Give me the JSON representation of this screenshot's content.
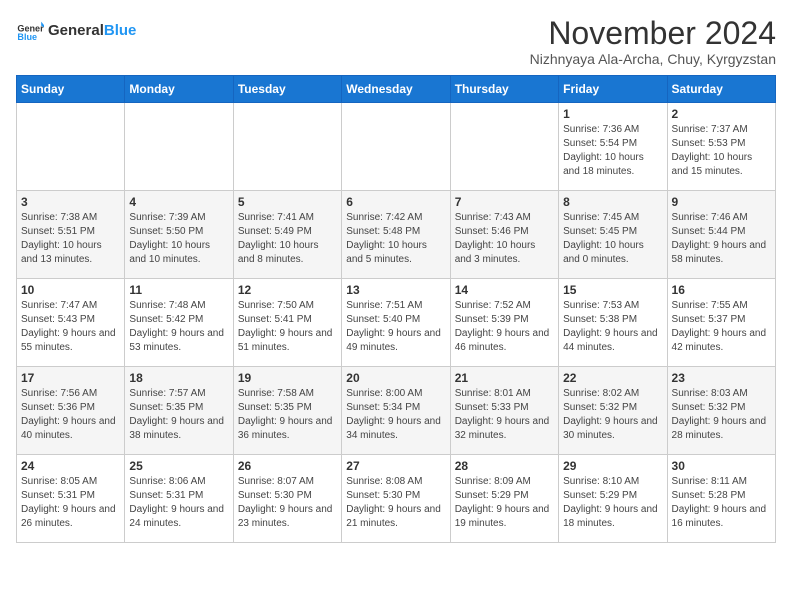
{
  "header": {
    "logo_general": "General",
    "logo_blue": "Blue",
    "month": "November 2024",
    "location": "Nizhnyaya Ala-Archa, Chuy, Kyrgyzstan"
  },
  "weekdays": [
    "Sunday",
    "Monday",
    "Tuesday",
    "Wednesday",
    "Thursday",
    "Friday",
    "Saturday"
  ],
  "weeks": [
    [
      {
        "day": "",
        "info": ""
      },
      {
        "day": "",
        "info": ""
      },
      {
        "day": "",
        "info": ""
      },
      {
        "day": "",
        "info": ""
      },
      {
        "day": "",
        "info": ""
      },
      {
        "day": "1",
        "info": "Sunrise: 7:36 AM\nSunset: 5:54 PM\nDaylight: 10 hours and 18 minutes."
      },
      {
        "day": "2",
        "info": "Sunrise: 7:37 AM\nSunset: 5:53 PM\nDaylight: 10 hours and 15 minutes."
      }
    ],
    [
      {
        "day": "3",
        "info": "Sunrise: 7:38 AM\nSunset: 5:51 PM\nDaylight: 10 hours and 13 minutes."
      },
      {
        "day": "4",
        "info": "Sunrise: 7:39 AM\nSunset: 5:50 PM\nDaylight: 10 hours and 10 minutes."
      },
      {
        "day": "5",
        "info": "Sunrise: 7:41 AM\nSunset: 5:49 PM\nDaylight: 10 hours and 8 minutes."
      },
      {
        "day": "6",
        "info": "Sunrise: 7:42 AM\nSunset: 5:48 PM\nDaylight: 10 hours and 5 minutes."
      },
      {
        "day": "7",
        "info": "Sunrise: 7:43 AM\nSunset: 5:46 PM\nDaylight: 10 hours and 3 minutes."
      },
      {
        "day": "8",
        "info": "Sunrise: 7:45 AM\nSunset: 5:45 PM\nDaylight: 10 hours and 0 minutes."
      },
      {
        "day": "9",
        "info": "Sunrise: 7:46 AM\nSunset: 5:44 PM\nDaylight: 9 hours and 58 minutes."
      }
    ],
    [
      {
        "day": "10",
        "info": "Sunrise: 7:47 AM\nSunset: 5:43 PM\nDaylight: 9 hours and 55 minutes."
      },
      {
        "day": "11",
        "info": "Sunrise: 7:48 AM\nSunset: 5:42 PM\nDaylight: 9 hours and 53 minutes."
      },
      {
        "day": "12",
        "info": "Sunrise: 7:50 AM\nSunset: 5:41 PM\nDaylight: 9 hours and 51 minutes."
      },
      {
        "day": "13",
        "info": "Sunrise: 7:51 AM\nSunset: 5:40 PM\nDaylight: 9 hours and 49 minutes."
      },
      {
        "day": "14",
        "info": "Sunrise: 7:52 AM\nSunset: 5:39 PM\nDaylight: 9 hours and 46 minutes."
      },
      {
        "day": "15",
        "info": "Sunrise: 7:53 AM\nSunset: 5:38 PM\nDaylight: 9 hours and 44 minutes."
      },
      {
        "day": "16",
        "info": "Sunrise: 7:55 AM\nSunset: 5:37 PM\nDaylight: 9 hours and 42 minutes."
      }
    ],
    [
      {
        "day": "17",
        "info": "Sunrise: 7:56 AM\nSunset: 5:36 PM\nDaylight: 9 hours and 40 minutes."
      },
      {
        "day": "18",
        "info": "Sunrise: 7:57 AM\nSunset: 5:35 PM\nDaylight: 9 hours and 38 minutes."
      },
      {
        "day": "19",
        "info": "Sunrise: 7:58 AM\nSunset: 5:35 PM\nDaylight: 9 hours and 36 minutes."
      },
      {
        "day": "20",
        "info": "Sunrise: 8:00 AM\nSunset: 5:34 PM\nDaylight: 9 hours and 34 minutes."
      },
      {
        "day": "21",
        "info": "Sunrise: 8:01 AM\nSunset: 5:33 PM\nDaylight: 9 hours and 32 minutes."
      },
      {
        "day": "22",
        "info": "Sunrise: 8:02 AM\nSunset: 5:32 PM\nDaylight: 9 hours and 30 minutes."
      },
      {
        "day": "23",
        "info": "Sunrise: 8:03 AM\nSunset: 5:32 PM\nDaylight: 9 hours and 28 minutes."
      }
    ],
    [
      {
        "day": "24",
        "info": "Sunrise: 8:05 AM\nSunset: 5:31 PM\nDaylight: 9 hours and 26 minutes."
      },
      {
        "day": "25",
        "info": "Sunrise: 8:06 AM\nSunset: 5:31 PM\nDaylight: 9 hours and 24 minutes."
      },
      {
        "day": "26",
        "info": "Sunrise: 8:07 AM\nSunset: 5:30 PM\nDaylight: 9 hours and 23 minutes."
      },
      {
        "day": "27",
        "info": "Sunrise: 8:08 AM\nSunset: 5:30 PM\nDaylight: 9 hours and 21 minutes."
      },
      {
        "day": "28",
        "info": "Sunrise: 8:09 AM\nSunset: 5:29 PM\nDaylight: 9 hours and 19 minutes."
      },
      {
        "day": "29",
        "info": "Sunrise: 8:10 AM\nSunset: 5:29 PM\nDaylight: 9 hours and 18 minutes."
      },
      {
        "day": "30",
        "info": "Sunrise: 8:11 AM\nSunset: 5:28 PM\nDaylight: 9 hours and 16 minutes."
      }
    ]
  ]
}
